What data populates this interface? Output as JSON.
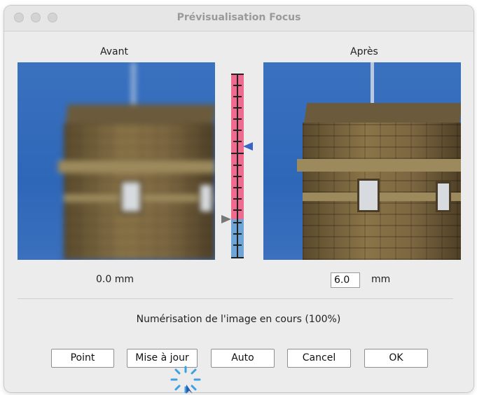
{
  "window": {
    "title": "Prévisualisation Focus"
  },
  "before": {
    "label": "Avant",
    "value_text": "0.0  mm"
  },
  "after": {
    "label": "Après",
    "value": "6.0",
    "unit": "mm"
  },
  "status": "Numérisation de l'image en cours (100%)",
  "buttons": {
    "point": "Point",
    "update": "Mise à jour",
    "auto": "Auto",
    "cancel": "Cancel",
    "ok": "OK"
  },
  "colors": {
    "scale_pink": "#ee6b8f",
    "scale_blue": "#6fa4d7",
    "marker_blue": "#3a64c8",
    "marker_gray": "#777777",
    "spinner": "#3ba1e6"
  }
}
